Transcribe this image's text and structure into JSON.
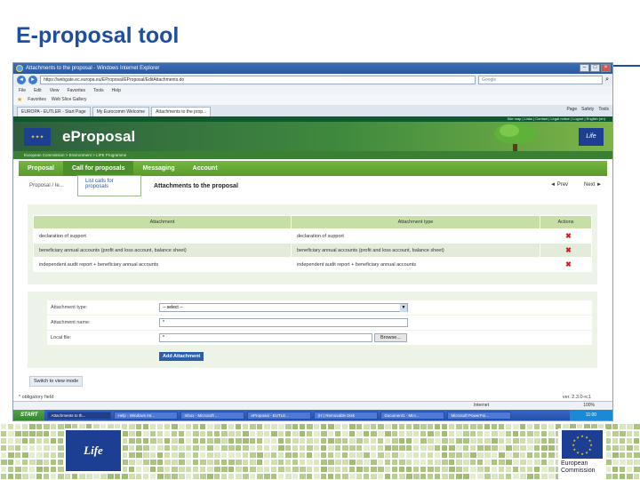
{
  "slide": {
    "title": "E-proposal tool"
  },
  "browser": {
    "window_title": "Attachments to the proposal - Windows Internet Explorer",
    "address": "https://webgate.ec.europa.eu/EProposal/EProposal/EditAttachments.do",
    "search_placeholder": "Google",
    "menu": [
      "File",
      "Edit",
      "View",
      "Favorites",
      "Tools",
      "Help"
    ],
    "favorites_label": "Favorites",
    "web_slice_label": "Web Slice Gallery",
    "tabs": [
      "EUROPA - EUTLER - Start Page",
      "My Eurocomm Welcome",
      "Attachments to the prop..."
    ],
    "toolbar_right": [
      "Page",
      "Safety",
      "Tools"
    ]
  },
  "portal": {
    "top_links": "Site map | Links | Contact | Legal notice | Logout | English (en)",
    "app_title": "eProposal",
    "life_logo": "Life",
    "breadcrumb": "European Commission > Environment > LIFE Programme",
    "nav": {
      "tabs": [
        "Proposal",
        "Call for proposals",
        "Messaging",
        "Account"
      ],
      "dropdown_item": "List calls for proposals"
    },
    "crumb": "Proposal / Ie...",
    "heading": "Attachments to the proposal",
    "prev": "◄ Prev",
    "next": "Next ►",
    "table": {
      "headers": [
        "Attachment",
        "Attachment type",
        "Actions"
      ],
      "rows": [
        {
          "attachment": "declaration of support",
          "type": "declaration of support"
        },
        {
          "attachment": "beneficiary annual accounts (profit and loss account, balance sheet)",
          "type": "beneficiary annual accounts (profit and loss account, balance sheet)"
        },
        {
          "attachment": "independent audit report + beneficiary annual accounts",
          "type": "independent audit report + beneficiary annual accounts"
        }
      ]
    },
    "form": {
      "type_label": "Attachment type:",
      "type_value": "-- select --",
      "name_label": "Attachment name:",
      "name_value": "*",
      "file_label": "Local file:",
      "file_value": "*",
      "browse_label": "Browse...",
      "add_label": "Add Attachment"
    },
    "switch_label": "Switch to view mode",
    "obligatory": "* obligatory field",
    "version": "ver. 2.3.0-rc1"
  },
  "statusbar": {
    "zone": "Internet",
    "zoom": "100%"
  },
  "taskbar": {
    "start": "START",
    "tasks": [
      "Attachments to th...",
      "Help - Windows Int...",
      "Inbox - Microsoft ...",
      "eProposal - EUTLE...",
      "(H:) Removable Disk",
      "Document1 - Micr...",
      "Microsoft PowerPoi..."
    ],
    "clock": "11:00"
  },
  "footer": {
    "life_text": "Life",
    "ec_line1": "European",
    "ec_line2": "Commission"
  },
  "colors": {
    "title_blue": "#1f4e9c",
    "portal_green": "#5a9a2c",
    "eu_blue": "#1c3f94",
    "delete_red": "#d0201a"
  }
}
